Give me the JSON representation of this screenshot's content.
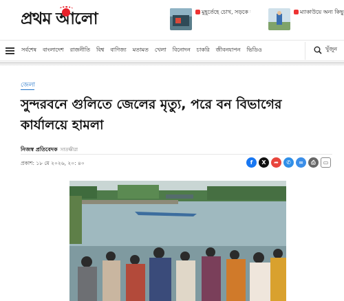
{
  "brand": {
    "logo_text": "প্রথম আলো"
  },
  "promos": [
    {
      "title": "মুহূর্তেহে চোখ, সড়কে ঝুঁকি"
    },
    {
      "title": "ম্যাকাউয়ে অন্য কিছুর হ্যারানো ভুলেন"
    }
  ],
  "nav": {
    "items": [
      "সর্বশেষ",
      "বাংলাদেশ",
      "রাজনীতি",
      "বিশ্ব",
      "বাণিজ্য",
      "মতামত",
      "খেলা",
      "বিনোদন",
      "চাকরি",
      "জীবনযাপন",
      "ভিডিও"
    ],
    "search_label": "খুঁজুন"
  },
  "article": {
    "section": "জেলা",
    "headline": "সুন্দরবনে গুলিতে জেলের মৃত্যু, পরে বন বিভাগের কার্যালয়ে হামলা",
    "author": "নিজস্ব প্রতিবেদক",
    "author_role": "সাতক্ষীরা",
    "published": "প্রকাশ: ১৮ মে ২০২৬, ২০: ৪০"
  },
  "share": [
    {
      "icon": "facebook-icon",
      "glyph": "f",
      "color": "#1877f2"
    },
    {
      "icon": "x-icon",
      "glyph": "X",
      "color": "#111111"
    },
    {
      "icon": "share-icon",
      "glyph": "➦",
      "color": "#e8453c"
    },
    {
      "icon": "whatsapp-icon",
      "glyph": "✆",
      "color": "#2f8fe8"
    },
    {
      "icon": "link-icon",
      "glyph": "∞",
      "color": "#3b8ee8"
    },
    {
      "icon": "print-icon",
      "glyph": "⎙",
      "color": "#666666"
    },
    {
      "icon": "bookmark-icon",
      "glyph": "▭",
      "color": "#ffffff"
    }
  ],
  "colors": {
    "brand_red": "#e8202a",
    "section_blue": "#1e72c8"
  }
}
